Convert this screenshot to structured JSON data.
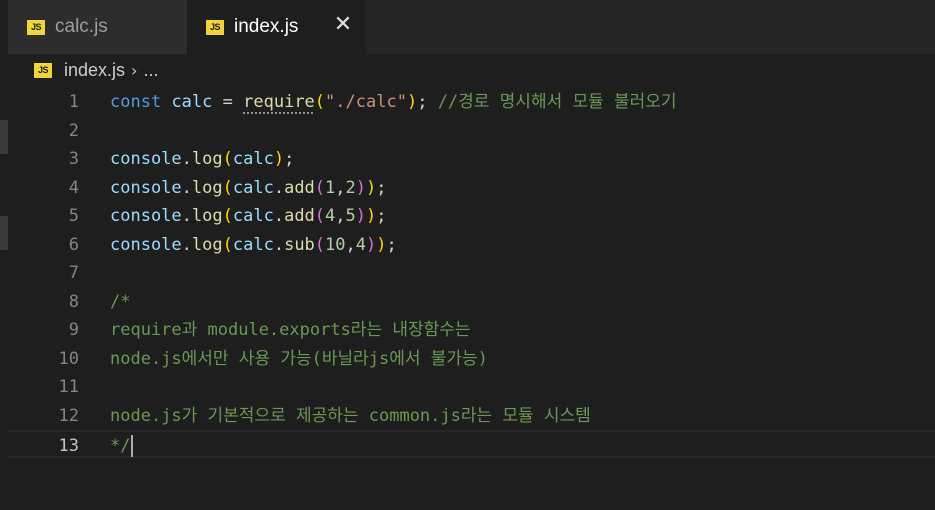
{
  "tabs": [
    {
      "label": "calc.js",
      "icon": "js-file-icon",
      "icon_text": "JS"
    },
    {
      "label": "index.js",
      "icon": "js-file-icon",
      "icon_text": "JS",
      "close": "✕"
    }
  ],
  "breadcrumb": {
    "file": "index.js",
    "separator": "›",
    "more": "..."
  },
  "colors": {
    "js_icon": "#f1d43a",
    "keyword": "#569cd6",
    "variable": "#9cdcfe",
    "function": "#dcdcaa",
    "string": "#ce9178",
    "number": "#b5cea8",
    "comment": "#6a9955"
  },
  "editor": {
    "active_line": 13,
    "line_numbers": [
      "1",
      "2",
      "3",
      "4",
      "5",
      "6",
      "7",
      "8",
      "9",
      "10",
      "11",
      "12",
      "13"
    ],
    "lines": [
      {
        "t1": "const",
        "t2": "calc",
        "t3": "=",
        "t4": "require",
        "t5": "(",
        "t6": "\"./calc\"",
        "t7": ")",
        "t8": ";",
        "t9": "//경로 명시해서 모듈 불러오기"
      },
      {},
      {
        "a": "console",
        "b": ".",
        "c": "log",
        "d": "(",
        "e": "calc",
        "f": ")",
        "g": ";"
      },
      {
        "a": "console",
        "b": ".",
        "c": "log",
        "d": "(",
        "e": "calc",
        "f": ".",
        "g": "add",
        "h": "(",
        "i": "1",
        "j": ",",
        "k": "2",
        "l": ")",
        "m": ")",
        "n": ";"
      },
      {
        "a": "console",
        "b": ".",
        "c": "log",
        "d": "(",
        "e": "calc",
        "f": ".",
        "g": "add",
        "h": "(",
        "i": "4",
        "j": ",",
        "k": "5",
        "l": ")",
        "m": ")",
        "n": ";"
      },
      {
        "a": "console",
        "b": ".",
        "c": "log",
        "d": "(",
        "e": "calc",
        "f": ".",
        "g": "sub",
        "h": "(",
        "i": "10",
        "j": ",",
        "k": "4",
        "l": ")",
        "m": ")",
        "n": ";"
      },
      {},
      {
        "text": "/*"
      },
      {
        "text": "require과 module.exports라는 내장함수는"
      },
      {
        "text": "node.js에서만 사용 가능(바닐라js에서 불가능)"
      },
      {},
      {
        "text": "node.js가 기본적으로 제공하는 common.js라는 모듈 시스템"
      },
      {
        "text": "*/"
      }
    ]
  }
}
